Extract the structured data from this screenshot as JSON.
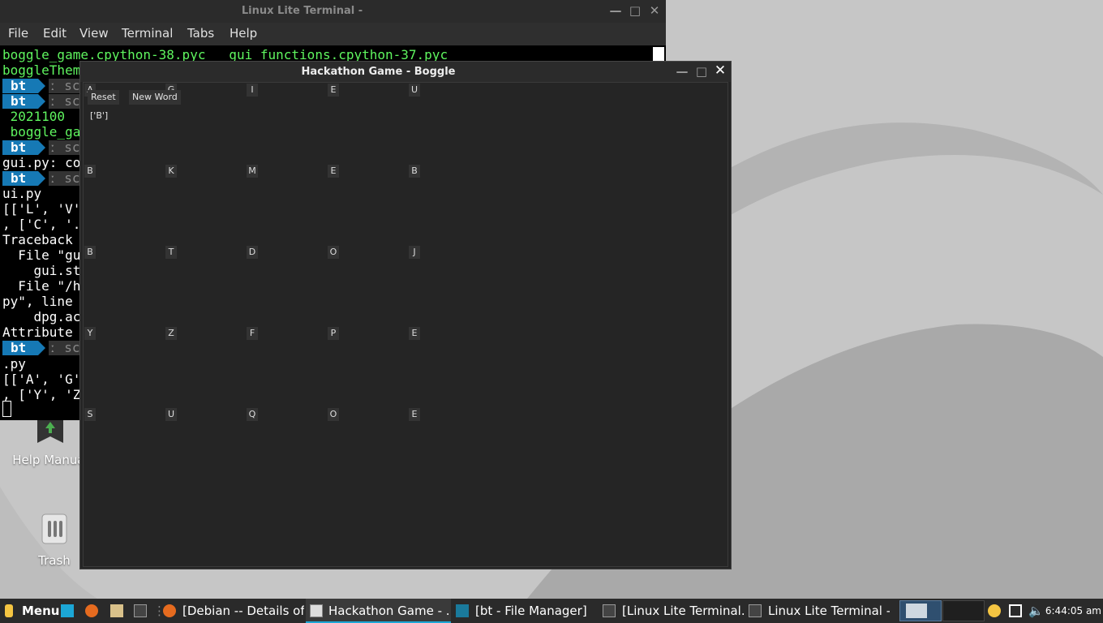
{
  "desktop": {
    "icons": [
      {
        "label": "Help Manual",
        "icon": "help-manual-icon"
      },
      {
        "label": "Trash",
        "icon": "trash-icon"
      }
    ]
  },
  "terminal": {
    "title": "Linux Lite Terminal -",
    "menu": [
      "File",
      "Edit",
      "View",
      "Terminal",
      "Tabs",
      "Help"
    ],
    "lines": {
      "l1": "boggle_game.cpython-38.pyc   gui_functions.cpython-37.pyc",
      "l2": "boggleThem",
      "l3": "bt",
      "l4": "bt",
      "l5": " 2021100",
      "l6": " boggle_ga",
      "l7": "bt",
      "l8": "gui.py: co",
      "l9": "bt",
      "l10": "ui.py",
      "l11": "[['L', 'V'",
      "l12": ", ['C', '.",
      "l13": "Traceback ",
      "l14": "  File \"gu",
      "l15": "    gui.st",
      "l16": "  File \"/h",
      "l17": "py\", line ",
      "l18": "    dpg.ac",
      "l19": "Attribute",
      "l20": "bt",
      "l21": ".py",
      "l22": "[['A', 'G'",
      "l23": ", ['Y', 'Z"
    },
    "prompt_fragment": "ː sc"
  },
  "boggle": {
    "title": "Hackathon Game - Boggle",
    "reset_label": "Reset",
    "new_word_label": "New Word",
    "current_word": "['B']",
    "grid": [
      [
        "A",
        "G",
        "I",
        "E",
        "U"
      ],
      [
        "B",
        "K",
        "M",
        "E",
        "B"
      ],
      [
        "B",
        "T",
        "D",
        "O",
        "J"
      ],
      [
        "Y",
        "Z",
        "F",
        "P",
        "E"
      ],
      [
        "S",
        "U",
        "Q",
        "O",
        "E"
      ]
    ]
  },
  "taskbar": {
    "menu_label": "Menu",
    "tasks": [
      {
        "label": "[Debian -- Details of ...",
        "active": false
      },
      {
        "label": "Hackathon Game - ...",
        "active": true
      },
      {
        "label": "[bt - File Manager]",
        "active": false
      },
      {
        "label": "[Linux Lite Terminal...",
        "active": false
      },
      {
        "label": "Linux Lite Terminal -",
        "active": false
      }
    ],
    "clock": "6:44:05 am"
  },
  "colors": {
    "accent": "#1679b5",
    "terminal_green": "#5ff55f",
    "taskbar_bg": "#2a2a2a"
  }
}
